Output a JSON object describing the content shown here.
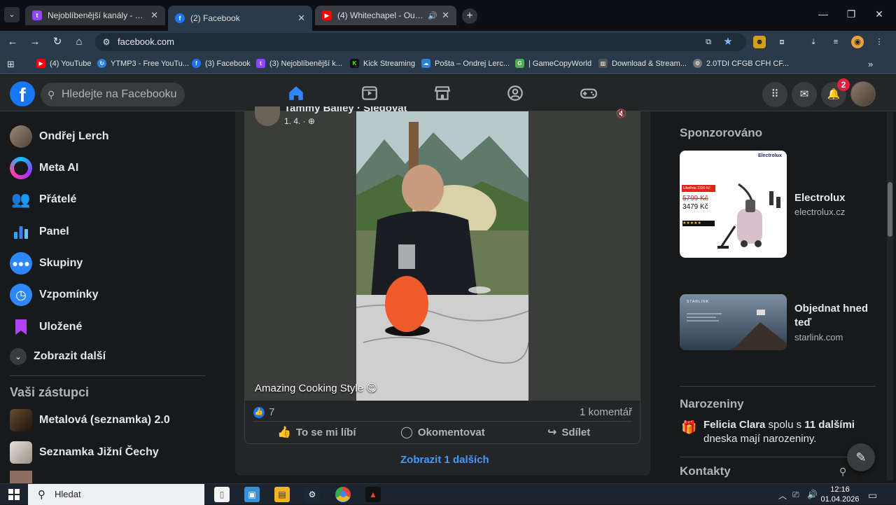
{
  "browser": {
    "tabs": [
      {
        "label": "Nejoblíbenější kanály - Twitch",
        "favicon": "twitch-icon",
        "color": "#9146ff"
      },
      {
        "label": "(2) Facebook",
        "favicon": "facebook-icon",
        "color": "#1877f2"
      },
      {
        "label": "(4) Whitechapel - Our Endl",
        "favicon": "youtube-icon",
        "color": "#ff0000"
      }
    ],
    "address": "facebook.com",
    "bookmarks": [
      {
        "label": "(4) YouTube",
        "color": "#ff0000"
      },
      {
        "label": "YTMP3 - Free YouTu...",
        "color": "#2b83d9"
      },
      {
        "label": "(3) Facebook",
        "color": "#1877f2"
      },
      {
        "label": "(3) Nejoblíbenější k...",
        "color": "#9146ff"
      },
      {
        "label": "Kick Streaming",
        "color": "#53fc18"
      },
      {
        "label": "Pošta – Ondrej Lerc...",
        "color": "#2a82d9"
      },
      {
        "label": "| GameCopyWorld",
        "color": "#4caf50"
      },
      {
        "label": "Download & Stream...",
        "color": "#888888"
      },
      {
        "label": "2.0TDI CFGB CFH CF...",
        "color": "#cccccc"
      }
    ]
  },
  "header": {
    "search_placeholder": "Hledejte na Facebooku",
    "notification_count": "2"
  },
  "sidebar": {
    "items": [
      {
        "label": "Ondřej Lerch",
        "icon": "profile-avatar"
      },
      {
        "label": "Meta AI",
        "icon": "meta-ai-icon"
      },
      {
        "label": "Přátelé",
        "icon": "friends-icon"
      },
      {
        "label": "Panel",
        "icon": "dashboard-icon"
      },
      {
        "label": "Skupiny",
        "icon": "groups-icon"
      },
      {
        "label": "Vzpomínky",
        "icon": "memories-icon"
      },
      {
        "label": "Uložené",
        "icon": "saved-icon"
      },
      {
        "label": "Zobrazit další",
        "icon": "chevron-down-icon"
      }
    ],
    "shortcuts_title": "Vaši zástupci",
    "shortcuts": [
      {
        "label": "Metalová (seznamka) 2.0"
      },
      {
        "label": "Seznamka Jižní Čechy"
      }
    ]
  },
  "post": {
    "author": "Tammy Bailey · Sledovat",
    "date": "1. 4. ·",
    "caption": "Amazing Cooking Style 😋",
    "reactions": "7",
    "comments": "1 komentář",
    "actions": {
      "like": "To se mi líbí",
      "comment": "Okomentovat",
      "share": "Sdílet"
    },
    "more": "Zobrazit 1 dalších"
  },
  "right": {
    "sponsored_title": "Sponzorováno",
    "ads": [
      {
        "name": "Electrolux",
        "url": "electrolux.cz",
        "old_price": "5799 Kč",
        "price": "3479 Kč",
        "promo": "Ušetřete 2320 Kč",
        "brand": "Electrolux"
      },
      {
        "name": "Objednat hned teď",
        "url": "starlink.com",
        "brand": "STARLINK"
      }
    ],
    "birthdays_title": "Narozeniny",
    "birthday_name": "Felicia Clara",
    "birthday_mid": " spolu s ",
    "birthday_count": "11 dalšími",
    "birthday_end": " dneska mají narozeniny.",
    "contacts_title": "Kontakty"
  },
  "taskbar": {
    "search_placeholder": "Hledat",
    "time": "12:16",
    "date": "01.04.2026"
  }
}
